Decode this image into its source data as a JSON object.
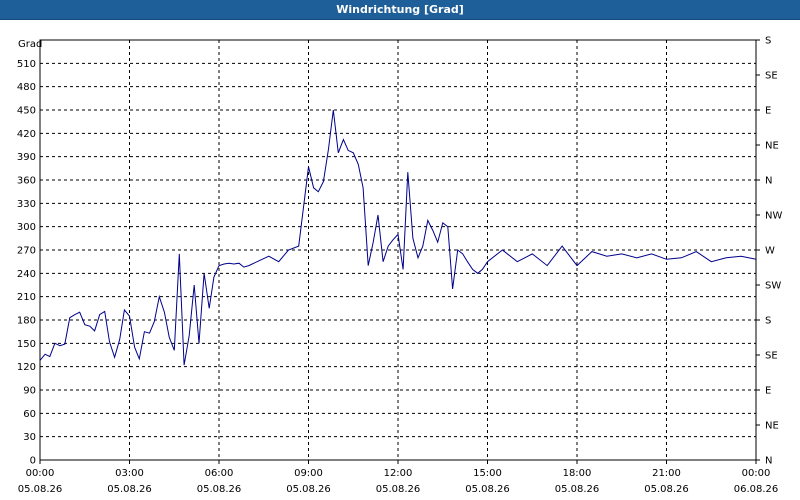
{
  "window": {
    "title": "Windrichtung [Grad]"
  },
  "chart_data": {
    "type": "line",
    "title": "Windrichtung [Grad]",
    "ylabel": "Grad",
    "xlabel": "",
    "ylim": [
      0,
      540
    ],
    "xlim": [
      0,
      24
    ],
    "grid": true,
    "y_ticks": [
      0,
      30,
      60,
      90,
      120,
      150,
      180,
      210,
      240,
      270,
      300,
      330,
      360,
      390,
      420,
      450,
      480,
      510
    ],
    "right_ticks": [
      {
        "v": 0,
        "label": "N"
      },
      {
        "v": 45,
        "label": "NE"
      },
      {
        "v": 90,
        "label": "E"
      },
      {
        "v": 135,
        "label": "SE"
      },
      {
        "v": 180,
        "label": "S"
      },
      {
        "v": 225,
        "label": "SW"
      },
      {
        "v": 270,
        "label": "W"
      },
      {
        "v": 315,
        "label": "NW"
      },
      {
        "v": 360,
        "label": "N"
      },
      {
        "v": 405,
        "label": "NE"
      },
      {
        "v": 450,
        "label": "E"
      },
      {
        "v": 495,
        "label": "SE"
      },
      {
        "v": 540,
        "label": "S"
      }
    ],
    "x_ticks": [
      {
        "v": 0,
        "time": "00:00",
        "date": "05.08.26"
      },
      {
        "v": 3,
        "time": "03:00",
        "date": "05.08.26"
      },
      {
        "v": 6,
        "time": "06:00",
        "date": "05.08.26"
      },
      {
        "v": 9,
        "time": "09:00",
        "date": "05.08.26"
      },
      {
        "v": 12,
        "time": "12:00",
        "date": "05.08.26"
      },
      {
        "v": 15,
        "time": "15:00",
        "date": "05.08.26"
      },
      {
        "v": 18,
        "time": "18:00",
        "date": "05.08.26"
      },
      {
        "v": 21,
        "time": "21:00",
        "date": "05.08.26"
      },
      {
        "v": 24,
        "time": "00:00",
        "date": "06.08.26"
      }
    ],
    "colors": {
      "line": "#00008b",
      "grid": "#000000",
      "titlebar": "#1f5f99"
    },
    "series": [
      {
        "x": [
          0,
          0.17,
          0.33,
          0.5,
          0.67,
          0.83,
          1.0,
          1.17,
          1.33,
          1.5,
          1.67,
          1.83,
          2.0,
          2.17,
          2.33,
          2.5,
          2.67,
          2.83,
          3.0,
          3.17,
          3.33,
          3.5,
          3.67,
          3.83,
          4.0,
          4.17,
          4.33,
          4.5,
          4.67,
          4.83,
          5.0,
          5.17,
          5.33,
          5.5,
          5.67,
          5.83,
          6.0,
          6.17,
          6.33,
          6.5,
          6.67,
          6.83,
          7.0,
          7.33,
          7.67,
          8.0,
          8.33,
          8.67,
          9.0,
          9.17,
          9.33,
          9.5,
          9.67,
          9.83,
          10.0,
          10.17,
          10.33,
          10.5,
          10.67,
          10.83,
          11.0,
          11.17,
          11.33,
          11.5,
          11.67,
          11.83,
          12.0,
          12.17,
          12.33,
          12.5,
          12.67,
          12.83,
          13.0,
          13.17,
          13.33,
          13.5,
          13.67,
          13.83,
          14.0,
          14.17,
          14.33,
          14.5,
          14.67,
          14.83,
          15.0,
          15.5,
          16.0,
          16.5,
          17.0,
          17.5,
          18.0,
          18.5,
          19.0,
          19.5,
          20.0,
          20.5,
          21.0,
          21.5,
          22.0,
          22.5,
          23.0,
          23.5,
          24.0
        ],
        "y": [
          128,
          136,
          133,
          150,
          147,
          149,
          183,
          187,
          190,
          174,
          172,
          166,
          187,
          191,
          152,
          132,
          155,
          193,
          185,
          145,
          130,
          165,
          163,
          178,
          210,
          190,
          158,
          141,
          265,
          122,
          160,
          225,
          150,
          240,
          195,
          235,
          250,
          252,
          253,
          252,
          253,
          248,
          250,
          256,
          262,
          255,
          270,
          275,
          377,
          350,
          345,
          358,
          400,
          450,
          395,
          412,
          398,
          395,
          380,
          350,
          250,
          280,
          315,
          255,
          275,
          283,
          290,
          245,
          370,
          285,
          260,
          275,
          308,
          295,
          280,
          305,
          300,
          220,
          270,
          265,
          255,
          245,
          240,
          245,
          255,
          270,
          255,
          265,
          250,
          275,
          250,
          268,
          262,
          265,
          260,
          265,
          258,
          260,
          268,
          255,
          260,
          262,
          258
        ]
      }
    ]
  }
}
